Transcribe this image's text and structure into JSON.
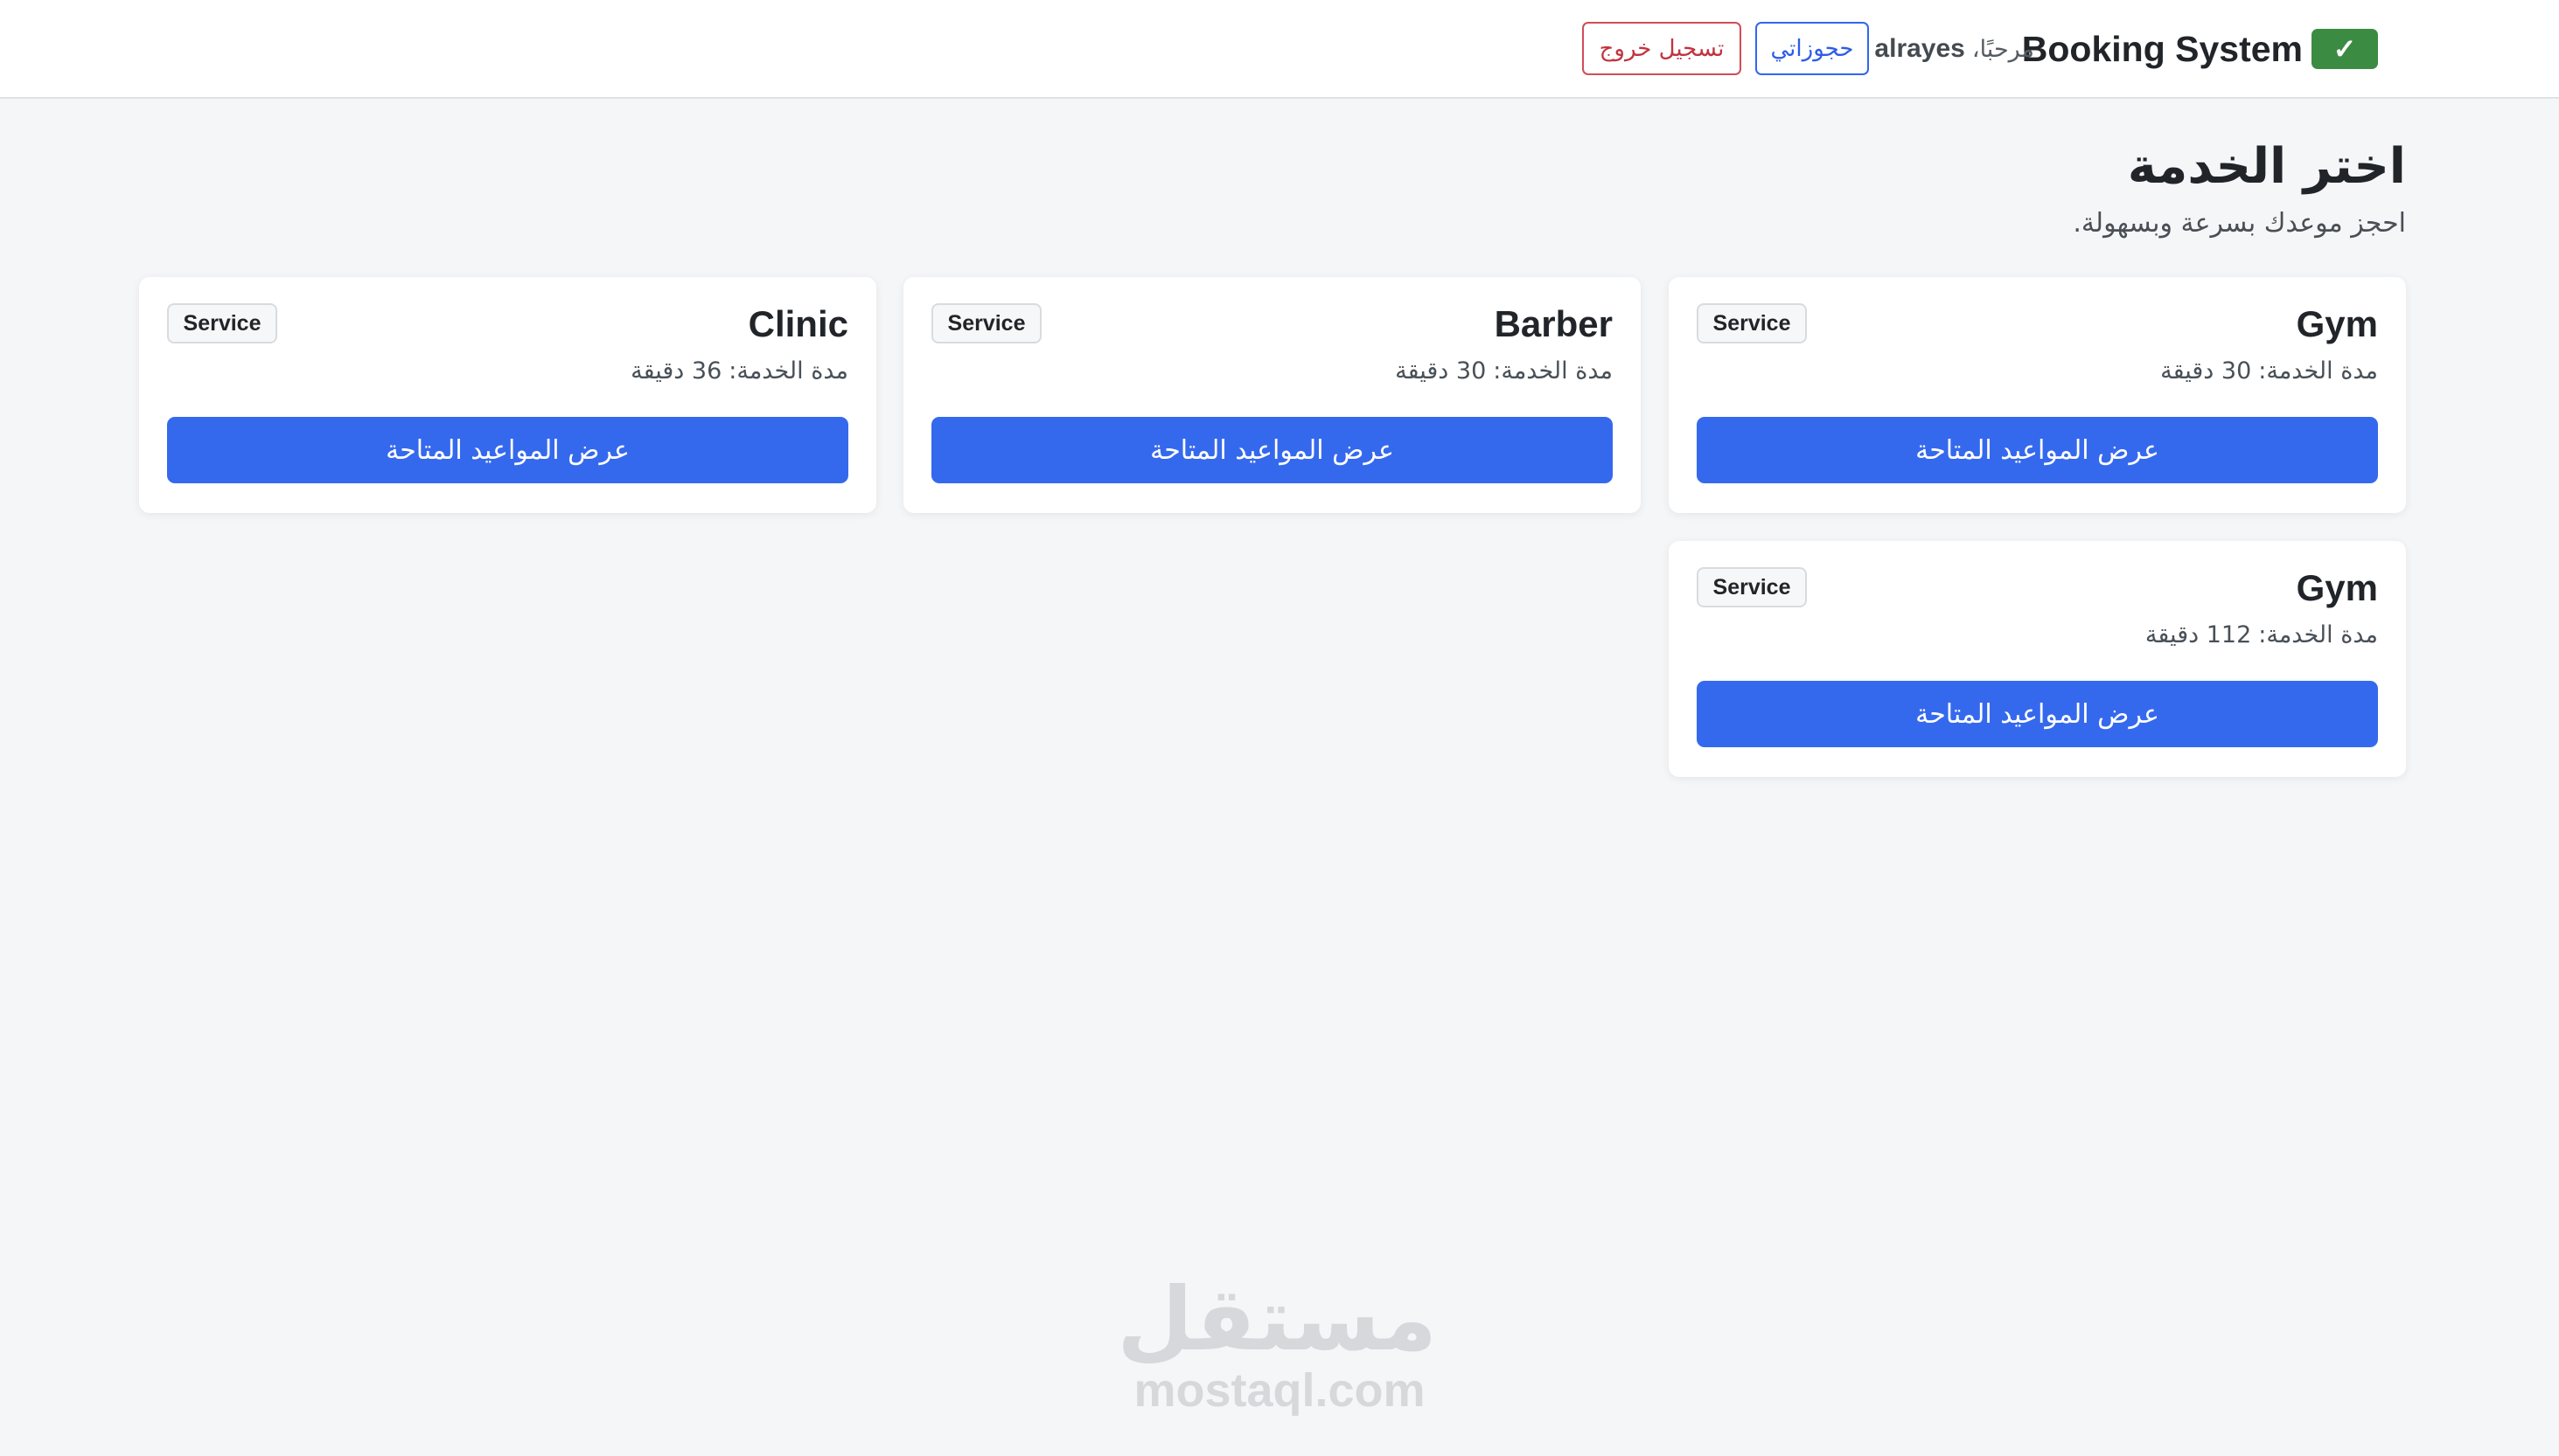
{
  "navbar": {
    "brand": "Booking System",
    "brand_icon": "check-mark-icon",
    "greeting_prefix": "مرحبًا،",
    "username": "alrayes",
    "bookings_label": "حجوزاتي",
    "logout_label": "تسجيل خروج"
  },
  "page": {
    "title": "اختر الخدمة",
    "subtitle": "احجز موعدك بسرعة وبسهولة."
  },
  "services": [
    {
      "name": "Gym",
      "badge": "Service",
      "duration_label": "مدة الخدمة:",
      "duration_value": "30 دقيقة",
      "button_label": "عرض المواعيد المتاحة"
    },
    {
      "name": "Barber",
      "badge": "Service",
      "duration_label": "مدة الخدمة:",
      "duration_value": "30 دقيقة",
      "button_label": "عرض المواعيد المتاحة"
    },
    {
      "name": "Clinic",
      "badge": "Service",
      "duration_label": "مدة الخدمة:",
      "duration_value": "36 دقيقة",
      "button_label": "عرض المواعيد المتاحة"
    },
    {
      "name": "Gym",
      "badge": "Service",
      "duration_label": "مدة الخدمة:",
      "duration_value": "112 دقيقة",
      "button_label": "عرض المواعيد المتاحة"
    }
  ],
  "watermark": {
    "arabic": "مستقل",
    "latin": "mostaql.com"
  },
  "colors": {
    "primary": "#3569ed",
    "danger": "#c0343f",
    "success": "#3c8b43",
    "background": "#f5f6f8"
  }
}
